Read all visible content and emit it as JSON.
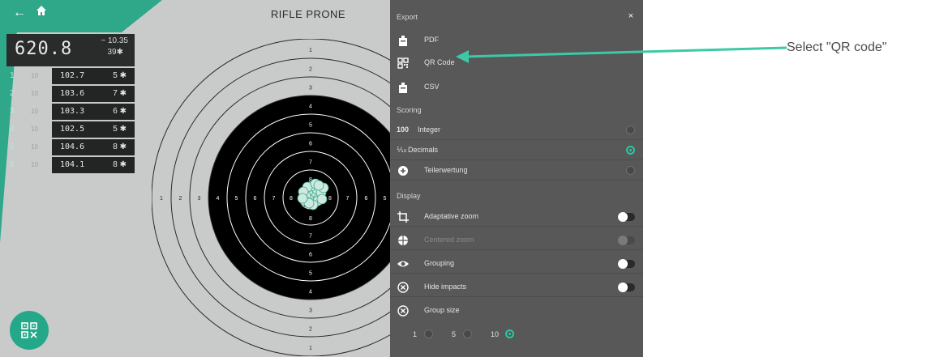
{
  "header": {
    "title": "RIFLE PRONE",
    "back_icon": "arrow-left-icon",
    "home_icon": "home-icon"
  },
  "score": {
    "total": "620.8",
    "deviation": "~ 10.35",
    "inner_tens": "39✱"
  },
  "series": [
    {
      "index": "1",
      "shots": "10",
      "value": "102.7",
      "count": "5 ✱"
    },
    {
      "index": "2",
      "shots": "10",
      "value": "103.6",
      "count": "7 ✱"
    },
    {
      "index": "3",
      "shots": "10",
      "value": "103.3",
      "count": "6 ✱"
    },
    {
      "index": "4",
      "shots": "10",
      "value": "102.5",
      "count": "5 ✱"
    },
    {
      "index": "5",
      "shots": "10",
      "value": "104.6",
      "count": "8 ✱"
    },
    {
      "index": "6",
      "shots": "10",
      "value": "104.1",
      "count": "8 ✱"
    }
  ],
  "target": {
    "ring_numbers_vertical": [
      "1",
      "2",
      "3",
      "4",
      "5",
      "6",
      "7",
      "8"
    ],
    "ring_numbers_horizontal": [
      "1",
      "2",
      "3",
      "4",
      "5",
      "6",
      "7",
      "8"
    ]
  },
  "export_panel": {
    "title": "Export",
    "close": "×",
    "formats": [
      {
        "label": "PDF",
        "icon": "pdf-icon"
      },
      {
        "label": "QR Code",
        "icon": "qr-code-icon"
      },
      {
        "label": "CSV",
        "icon": "csv-icon"
      }
    ],
    "scoring_heading": "Scoring",
    "scoring_options": [
      {
        "prefix": "100",
        "label": "Integer",
        "selected": false
      },
      {
        "prefix": "⅒",
        "label": "Decimals",
        "selected": true
      },
      {
        "prefix": "",
        "label": "Teilerwertung",
        "selected": false
      }
    ],
    "display_heading": "Display",
    "display_options": [
      {
        "label": "Adaptative zoom",
        "icon": "crop-icon",
        "on": false,
        "enabled": true
      },
      {
        "label": "Centered zoom",
        "icon": "globe-icon",
        "on": false,
        "enabled": false
      },
      {
        "label": "Grouping",
        "icon": "eye-icon",
        "on": false,
        "enabled": true
      },
      {
        "label": "Hide impacts",
        "icon": "close-circle-icon",
        "on": false,
        "enabled": true
      }
    ],
    "group_size_label": "Group size",
    "group_sizes": [
      {
        "label": "1",
        "selected": false
      },
      {
        "label": "5",
        "selected": false
      },
      {
        "label": "10",
        "selected": true
      }
    ]
  },
  "fab": {
    "icon": "qr-code-icon"
  },
  "annotation": {
    "text": "Select \"QR code\""
  },
  "colors": {
    "accent": "#26c9a0",
    "panel": "#585858",
    "target_bg": "#c9cbcb"
  }
}
